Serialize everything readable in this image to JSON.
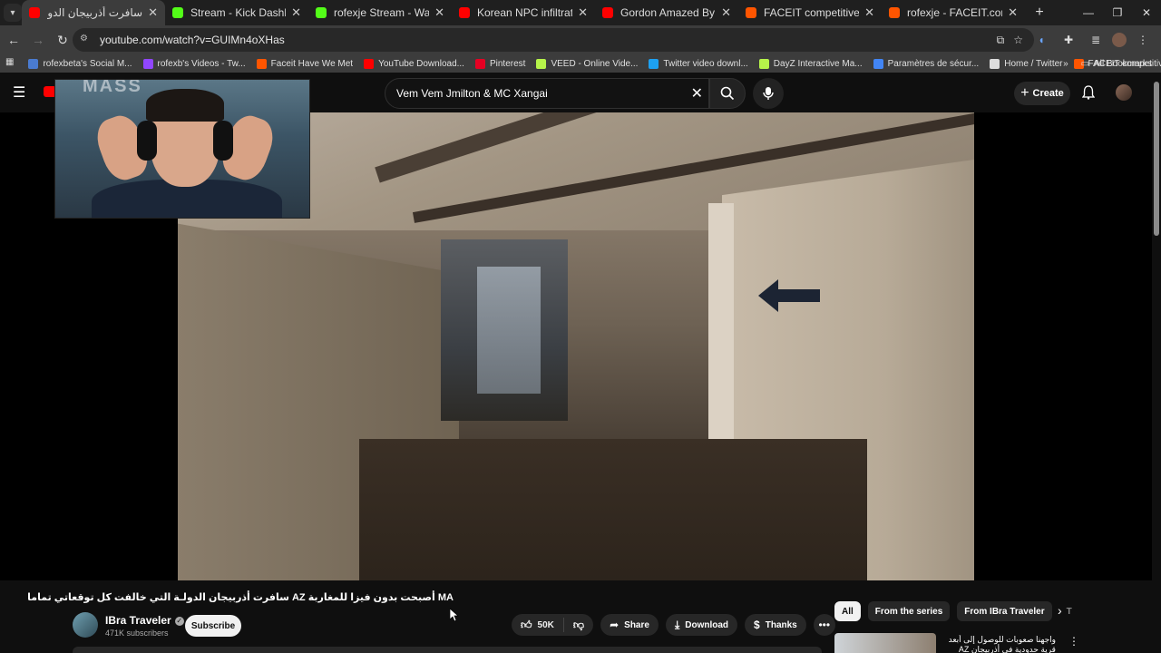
{
  "tabs": [
    {
      "title": "سافرت أذربيجان الدولة التي خالف",
      "favicon": "youtube-icon",
      "color": "#ff0000",
      "active": true
    },
    {
      "title": "Stream - Kick Dashboard",
      "favicon": "kick-icon",
      "color": "#53fc18",
      "active": false
    },
    {
      "title": "rofexje Stream - Watch Live on",
      "favicon": "kick-icon",
      "color": "#53fc18",
      "active": false
    },
    {
      "title": "Korean NPC infiltrates Sony HQ",
      "favicon": "youtube-icon",
      "color": "#ff0000",
      "active": false
    },
    {
      "title": "Gordon Amazed By Chef Who I",
      "favicon": "youtube-icon",
      "color": "#ff0000",
      "active": false
    },
    {
      "title": "FACEIT competitive match - FA",
      "favicon": "faceit-icon",
      "color": "#ff5500",
      "active": false
    },
    {
      "title": "rofexje - FACEIT.com",
      "favicon": "faceit-icon",
      "color": "#ff5500",
      "active": false
    }
  ],
  "address": {
    "url": "youtube.com/watch?v=GUIMn4oXHas"
  },
  "bookmarks": [
    {
      "label": "rofexbeta's Social M...",
      "color": "#4a7bd0"
    },
    {
      "label": "rofexb's Videos - Tw...",
      "color": "#9146ff"
    },
    {
      "label": "Faceit Have We Met",
      "color": "#ff5500"
    },
    {
      "label": "YouTube Download...",
      "color": "#ff0000"
    },
    {
      "label": "Pinterest",
      "color": "#e60023"
    },
    {
      "label": "VEED - Online Vide...",
      "color": "#b6f34a"
    },
    {
      "label": "Twitter video downl...",
      "color": "#1da1f2"
    },
    {
      "label": "DayZ Interactive Ma...",
      "color": "#b6f34a"
    },
    {
      "label": "Paramètres de sécur...",
      "color": "#4285f4"
    },
    {
      "label": "Home / Twitter",
      "color": "#dddddd"
    },
    {
      "label": "FACEIT competitive...",
      "color": "#ff5500"
    }
  ],
  "bookmarks_all": "All Bookmarks",
  "yt": {
    "search_query": "Vem Vem Jmilton & MC Xangai",
    "create_label": "Create"
  },
  "webcam": {
    "backdrop_text": "MASS"
  },
  "video": {
    "title": "MA أصبحت بدون فيزا للمغاربة AZ سافرت أذربيجان الدولـة التي خالفت كل توقعاتي تماما",
    "channel": "IBra Traveler",
    "subscribers": "471K subscribers",
    "subscribe_label": "Subscribe",
    "likes": "50K",
    "share_label": "Share",
    "download_label": "Download",
    "thanks_label": "Thanks"
  },
  "chips": [
    "All",
    "From the series",
    "From IBra Traveler",
    "T"
  ],
  "recommendation": {
    "title": "واجهنا صعوبات للوصول إلى أبعد قرية حدودية في أذربيجان AZ"
  }
}
